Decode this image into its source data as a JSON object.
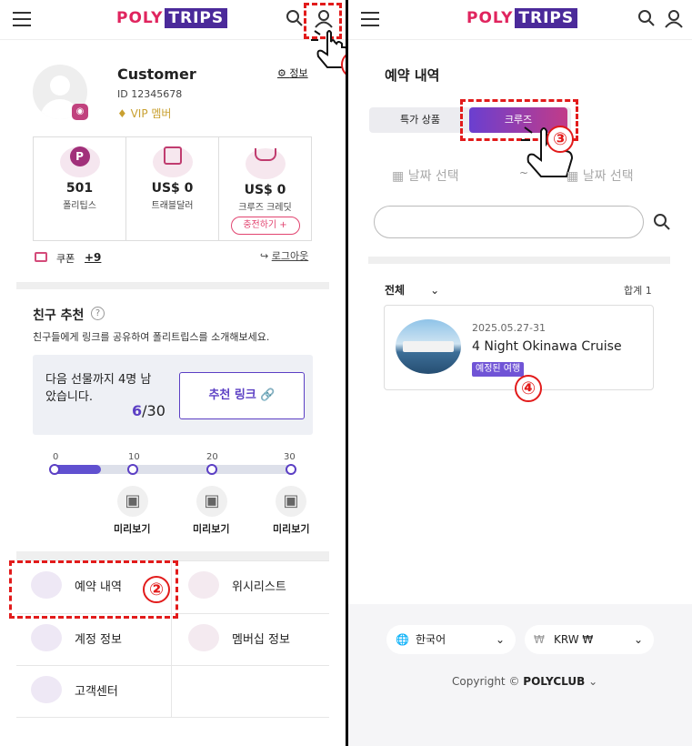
{
  "left": {
    "logo": {
      "part1": "POLY",
      "part2": "TRIPS"
    },
    "profile": {
      "name": "Customer",
      "id": "ID 12345678",
      "tier": "VIP 멤버",
      "info_link": "정보"
    },
    "stats": [
      {
        "value": "501",
        "label": "폴리팁스"
      },
      {
        "value": "US$ 0",
        "label": "트래블달러"
      },
      {
        "value": "US$ 0",
        "label": "크루즈 크레딧"
      }
    ],
    "charge_button": "충전하기 +",
    "coupon": {
      "label": "쿠폰",
      "count": "+9"
    },
    "logout": "로그아웃",
    "referral": {
      "title": "친구 추천",
      "desc": "친구들에게 링크를 공유하여 폴리트립스를 소개해보세요.",
      "gift_text_line1": "다음 선물까지 4명 남",
      "gift_text_line2": "았습니다.",
      "progress_current": "6",
      "progress_total": "/30",
      "link_button": "추천 링크",
      "ticks": [
        "0",
        "10",
        "20",
        "30"
      ],
      "progress_fraction": 0.2,
      "preview_labels": [
        "미리보기",
        "미리보기",
        "미리보기"
      ]
    },
    "menu": [
      {
        "label": "예약 내역"
      },
      {
        "label": "위시리스트"
      },
      {
        "label": "계정 정보"
      },
      {
        "label": "멤버십 정보"
      },
      {
        "label": "고객센터"
      }
    ]
  },
  "right": {
    "logo": {
      "part1": "POLY",
      "part2": "TRIPS"
    },
    "title": "예약 내역",
    "tabs": [
      "특가 상품",
      "크루즈"
    ],
    "date_from": "날짜 선택",
    "date_sep": "~",
    "date_to": "날짜 선택",
    "search_placeholder": "",
    "filter": "전체",
    "total_label": "합계",
    "total_count": "1",
    "booking": {
      "date": "2025.05.27-31",
      "title": "4 Night Okinawa Cruise",
      "status": "예정된 여행"
    },
    "footer": {
      "language": "한국어",
      "currency": "KRW ₩",
      "copyright_prefix": "Copyright ©",
      "copyright_brand": "POLYCLUB"
    }
  },
  "annotations": [
    "①",
    "②",
    "③",
    "④"
  ],
  "colors": {
    "accent": "#5b3fc4",
    "brand_pink": "#e0245e",
    "annotation_red": "#e21b1b"
  }
}
